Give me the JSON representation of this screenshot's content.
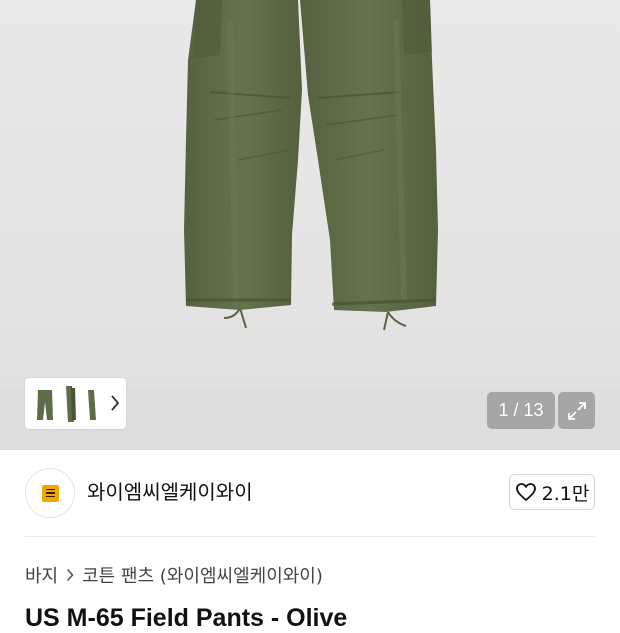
{
  "gallery": {
    "counter": "1 / 13",
    "expand_icon": "expand-icon",
    "thumbnail_arrow_icon": "chevron-right-icon"
  },
  "brand": {
    "name": "와이엠씨엘케이와이",
    "logo_text": "YMC LKY",
    "like_count": "2.1만",
    "like_icon": "heart-icon"
  },
  "breadcrumb": {
    "items": [
      "바지",
      "코튼 팬츠 (와이엠씨엘케이와이)"
    ]
  },
  "product": {
    "title": "US M-65 Field Pants - Olive"
  },
  "colors": {
    "olive": "#5f6c4a",
    "logo_yellow": "#f0a800"
  }
}
